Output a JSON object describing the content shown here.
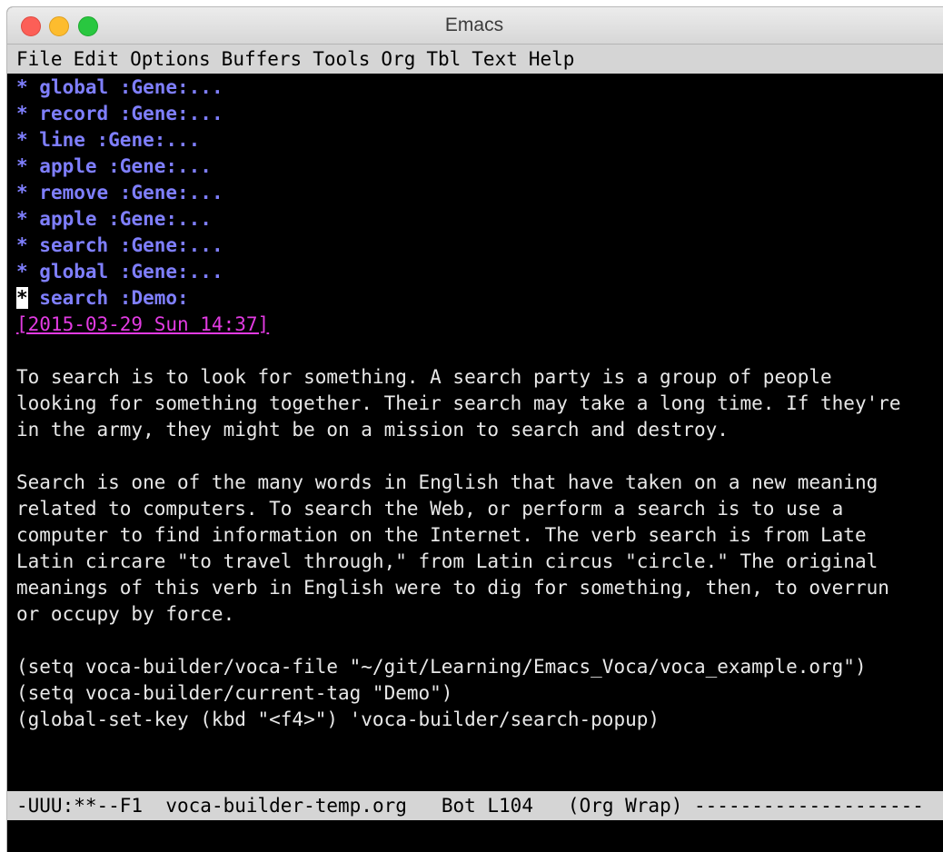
{
  "window": {
    "title": "Emacs"
  },
  "menubar": {
    "items": [
      "File",
      "Edit",
      "Options",
      "Buffers",
      "Tools",
      "Org",
      "Tbl",
      "Text",
      "Help"
    ]
  },
  "headings": [
    {
      "star": "*",
      "text": " global :Gene:..."
    },
    {
      "star": "*",
      "text": " record :Gene:..."
    },
    {
      "star": "*",
      "text": " line :Gene:..."
    },
    {
      "star": "*",
      "text": " apple :Gene:..."
    },
    {
      "star": "*",
      "text": " remove :Gene:..."
    },
    {
      "star": "*",
      "text": " apple :Gene:..."
    },
    {
      "star": "*",
      "text": " search :Gene:..."
    },
    {
      "star": "*",
      "text": " global :Gene:..."
    },
    {
      "star": "*",
      "text": " search :Demo:"
    }
  ],
  "timestamp": "[2015-03-29 Sun 14:37]",
  "paragraph1": [
    "To search is to look for something. A search party is a group of people",
    "looking for something together. Their search may take a long time. If they're",
    "in the army, they might be on a mission to search and destroy."
  ],
  "paragraph2": [
    "Search is one of the many words in English that have taken on a new meaning",
    "related to computers. To search the Web, or perform a search is to use a",
    "computer to find information on the Internet. The verb search is from Late",
    "Latin circare \"to travel through,\" from Latin circus \"circle.\" The original",
    "meanings of this verb in English were to dig for something, then, to overrun",
    "or occupy by force."
  ],
  "code": [
    "(setq voca-builder/voca-file \"~/git/Learning/Emacs_Voca/voca_example.org\")",
    "(setq voca-builder/current-tag \"Demo\")",
    "(global-set-key (kbd \"<f4>\") 'voca-builder/search-popup)"
  ],
  "modeline": {
    "status": "-UUU:**--F1",
    "buffer": "voca-builder-temp.org",
    "position": "Bot L104",
    "modes": "(Org Wrap)",
    "fill": "--------------------"
  },
  "colors": {
    "heading": "#7f7fff",
    "timestamp": "#e23be2",
    "text": "#e8e8e8",
    "background": "#000000",
    "menubar": "#d5d5d5"
  }
}
